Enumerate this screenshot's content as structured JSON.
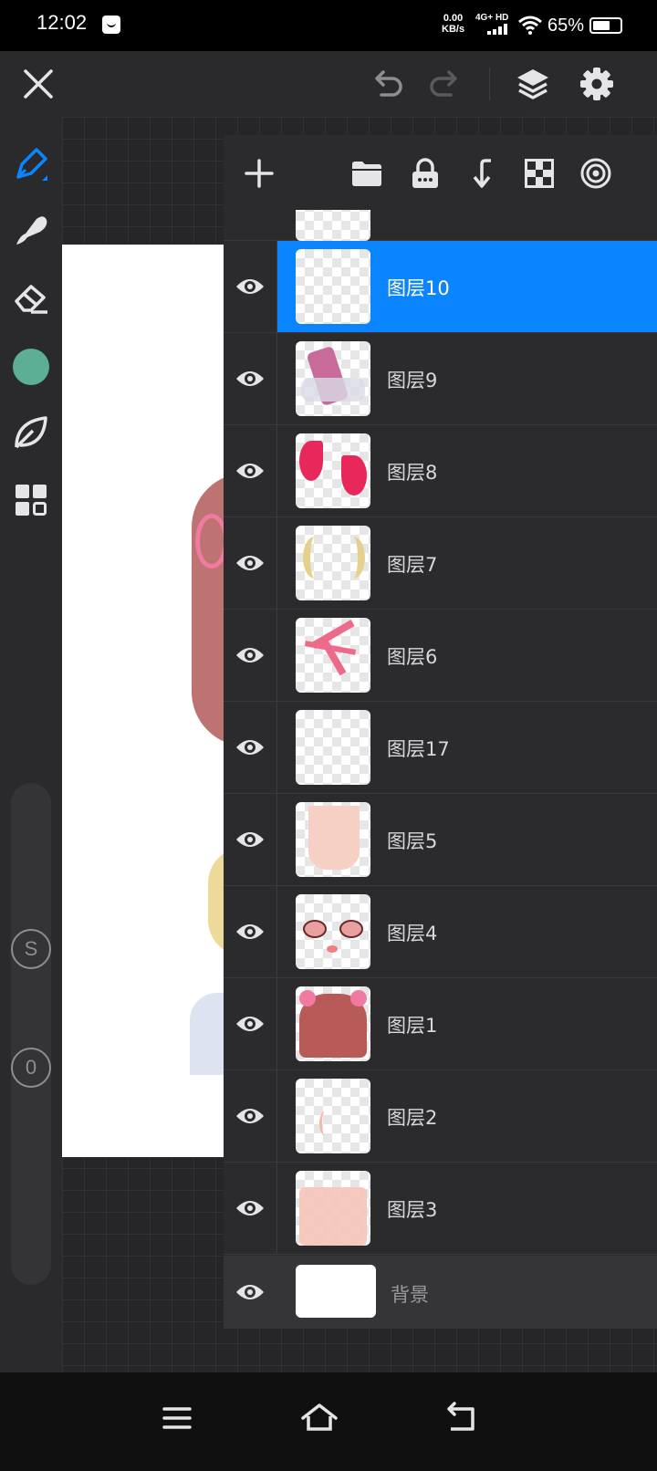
{
  "status_bar": {
    "time": "12:02",
    "net_speed_value": "0.00",
    "net_speed_unit": "KB/s",
    "network_type": "4G+ HD",
    "battery_percent_text": "65%",
    "battery_level": 0.65
  },
  "toolbar": {
    "icons": [
      "close-icon",
      "undo-icon",
      "redo-icon",
      "layers-icon",
      "gear-icon"
    ]
  },
  "left_rail": {
    "tools": [
      "brush-icon",
      "smudge-icon",
      "eraser-icon",
      "color-swatch",
      "leaf-icon",
      "grid-icon"
    ],
    "color": "#5cae94",
    "size_badge": "S",
    "opacity_badge": "0"
  },
  "layers_panel": {
    "toolbar_icons": [
      "add-icon",
      "folder-icon",
      "lock-icon",
      "merge-down-icon",
      "checker-icon",
      "target-icon"
    ],
    "selected_color": "#0a84ff",
    "layers": [
      {
        "name": "图层10",
        "selected": true
      },
      {
        "name": "图层9",
        "selected": false
      },
      {
        "name": "图层8",
        "selected": false
      },
      {
        "name": "图层7",
        "selected": false
      },
      {
        "name": "图层6",
        "selected": false
      },
      {
        "name": "图层17",
        "selected": false
      },
      {
        "name": "图层5",
        "selected": false
      },
      {
        "name": "图层4",
        "selected": false
      },
      {
        "name": "图层1",
        "selected": false
      },
      {
        "name": "图层2",
        "selected": false
      },
      {
        "name": "图层3",
        "selected": false
      }
    ],
    "background_layer": "背景"
  },
  "nav_bar": {
    "icons": [
      "menu-icon",
      "home-icon",
      "back-icon"
    ]
  }
}
